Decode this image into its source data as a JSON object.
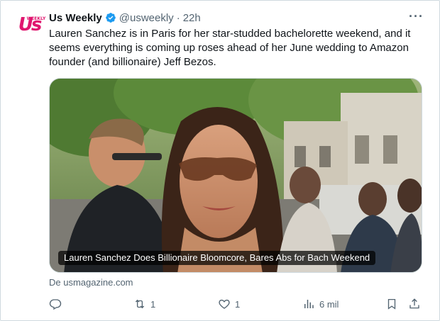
{
  "account": {
    "name": "Us Weekly",
    "handle": "@usweekly",
    "separator": "·",
    "time": "22h",
    "logo_text": "Us",
    "logo_small_text": "WEEKLY"
  },
  "tweet": {
    "text": "Lauren Sanchez is in Paris for her star-studded bachelorette weekend, and it seems everything is coming up roses ahead of her June wedding to Amazon founder (and billionaire) Jeff Bezos."
  },
  "media": {
    "caption": "Lauren Sanchez Does Billionaire Bloomcore, Bares Abs for Bach Weekend"
  },
  "link": {
    "source": "De usmagazine.com"
  },
  "actions": {
    "replies": "",
    "reposts": "1",
    "likes": "1",
    "views": "6 mil"
  },
  "colors": {
    "brand": "#e0176f",
    "verified": "#1d9bf0",
    "muted": "#536471"
  }
}
